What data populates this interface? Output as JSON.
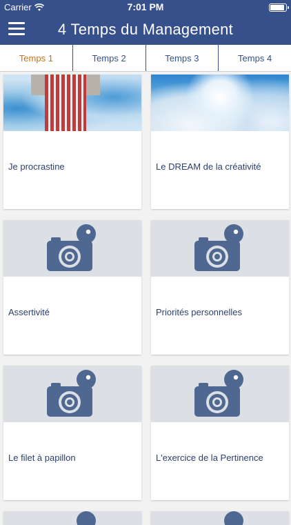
{
  "status_bar": {
    "carrier": "Carrier",
    "time": "7:01 PM"
  },
  "header": {
    "title": "4 Temps du Management",
    "menu_icon": "hamburger-menu-icon"
  },
  "tabs": [
    {
      "label": "Temps 1",
      "active": true
    },
    {
      "label": "Temps 2",
      "active": false
    },
    {
      "label": "Temps 3",
      "active": false
    },
    {
      "label": "Temps 4",
      "active": false
    }
  ],
  "cards": [
    {
      "label": "Je procrastine",
      "image": "photo"
    },
    {
      "label": "Le DREAM de la créativité",
      "image": "photo"
    },
    {
      "label": "Assertivité",
      "image": "camera-placeholder-icon"
    },
    {
      "label": "Priorités personnelles",
      "image": "camera-placeholder-icon"
    },
    {
      "label": "Le filet à papillon",
      "image": "camera-placeholder-icon"
    },
    {
      "label": "L'exercice de la Pertinence",
      "image": "camera-placeholder-icon"
    }
  ],
  "colors": {
    "header": "#35508a",
    "active_tab": "#c4731c",
    "tab_text": "#35508a",
    "placeholder_bg": "#dcdfe4",
    "camera": "#4f6891"
  }
}
